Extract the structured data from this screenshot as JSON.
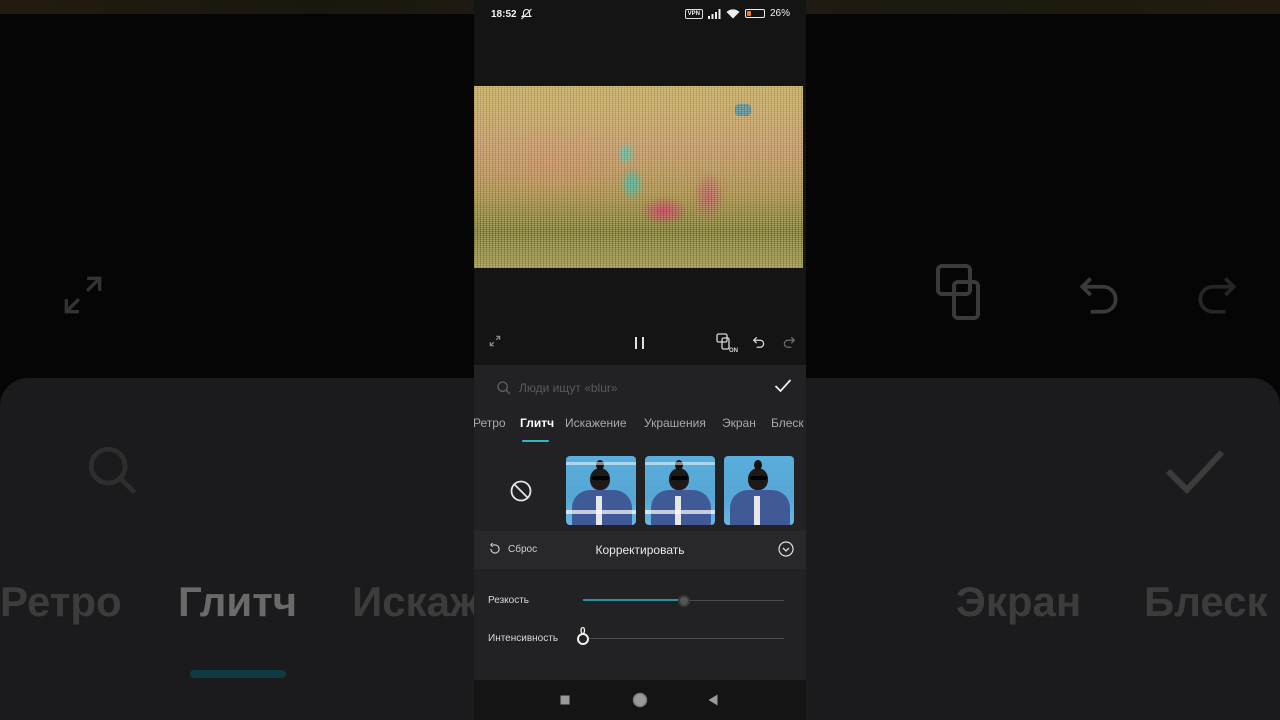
{
  "status_bar": {
    "time": "18:52",
    "vpn_label": "VPN",
    "battery": "26%",
    "battery_level": 0.26,
    "icons": [
      "mute-icon",
      "vpn-icon",
      "signal-icon",
      "wifi-icon",
      "battery-icon"
    ]
  },
  "player": {
    "icons": [
      "fullscreen-icon",
      "pause-icon",
      "compare-on-icon",
      "undo-icon",
      "redo-icon"
    ]
  },
  "search": {
    "placeholder": "Люди ищут «blur»"
  },
  "tabs": [
    "Ретро",
    "Глитч",
    "Искажение",
    "Украшения",
    "Экран",
    "Блеск"
  ],
  "active_tab": "Глитч",
  "effects": {
    "none_icon": "none-icon",
    "thumbnails": [
      "effect-1",
      "effect-2",
      "effect-3"
    ]
  },
  "adjust": {
    "reset_label": "Сброс",
    "title": "Корректировать"
  },
  "sliders": [
    {
      "label": "Резкость",
      "value": 0.5,
      "value_text": ""
    },
    {
      "label": "Интенсивность",
      "value": 0,
      "value_text": "0"
    }
  ],
  "navbar": {
    "icons": [
      "square-icon",
      "circle-icon",
      "back-triangle-icon"
    ]
  },
  "colors": {
    "accent": "#2fb7c4",
    "panel": "#222224",
    "background": "#141414"
  }
}
